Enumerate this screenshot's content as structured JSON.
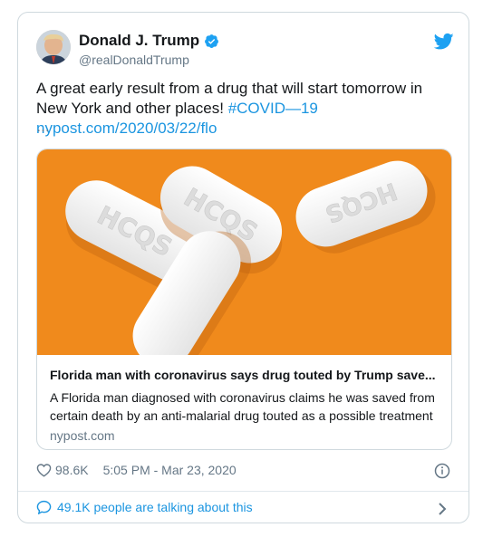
{
  "author": {
    "name": "Donald J. Trump",
    "handle": "@realDonaldTrump",
    "verified": true
  },
  "tweet": {
    "text": "A great early result from a drug that will start tomorrow in New York and other places! ",
    "hashtag": "#COVID—19",
    "link": "nypost.com/2020/03/22/flo",
    "ellipsis": "…"
  },
  "link_card": {
    "image_pill_text": "HCQS",
    "title": "Florida man with coronavirus says drug touted by Trump save...",
    "description": "A Florida man diagnosed with coronavirus claims he was saved from certain death by an anti-malarial drug touted as a possible treatment",
    "domain": "nypost.com"
  },
  "footer": {
    "likes": "98.6K",
    "timestamp": "5:05 PM - Mar 23, 2020",
    "talking": "49.1K people are talking about this"
  },
  "colors": {
    "accent": "#1b95e0",
    "image_background": "#f08a1c",
    "muted": "#657786"
  },
  "icons": [
    "twitter-bird-icon",
    "verified-badge-icon",
    "heart-icon",
    "info-icon",
    "comment-bubble-icon",
    "chevron-right-icon"
  ]
}
